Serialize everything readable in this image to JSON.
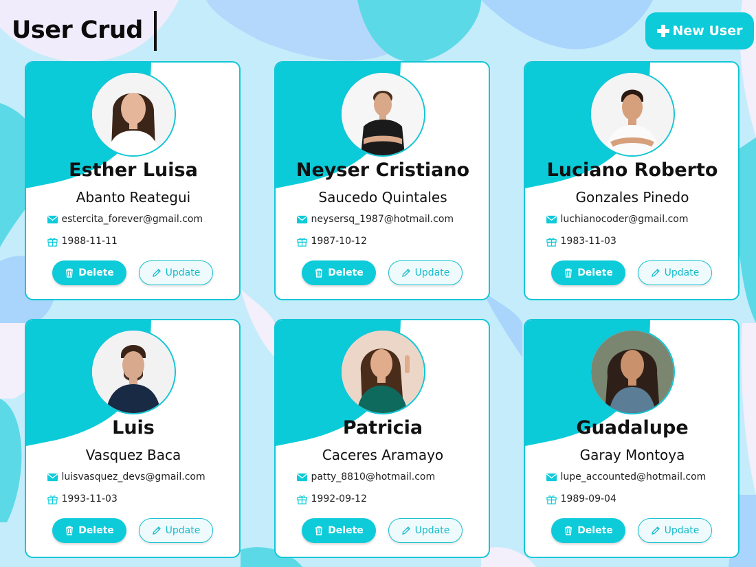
{
  "app": {
    "title": "User Crud",
    "new_user_label": "New User",
    "colors": {
      "accent": "#0dcbd9",
      "card_border": "#12c6d6",
      "background": "#c8ecfb"
    }
  },
  "icons": {
    "new_user": "plus-icon",
    "email": "mail-icon",
    "birthday": "gift-icon",
    "delete": "trash-icon",
    "update": "pencil-icon"
  },
  "cards": [
    {
      "first_name": "Esther Luisa",
      "last_name": "Abanto Reategui",
      "email": "estercita_forever@gmail.com",
      "birthday": "1988-11-11",
      "delete_label": "Delete",
      "update_label": "Update"
    },
    {
      "first_name": "Neyser Cristiano",
      "last_name": "Saucedo Quintales",
      "email": "neysersq_1987@hotmail.com",
      "birthday": "1987-10-12",
      "delete_label": "Delete",
      "update_label": "Update"
    },
    {
      "first_name": "Luciano Roberto",
      "last_name": "Gonzales Pinedo",
      "email": "luchianocoder@gmail.com",
      "birthday": "1983-11-03",
      "delete_label": "Delete",
      "update_label": "Update"
    },
    {
      "first_name": "Luis",
      "last_name": "Vasquez Baca",
      "email": "luisvasquez_devs@gmail.com",
      "birthday": "1993-11-03",
      "delete_label": "Delete",
      "update_label": "Update"
    },
    {
      "first_name": "Patricia",
      "last_name": "Caceres Aramayo",
      "email": "patty_8810@hotmail.com",
      "birthday": "1992-09-12",
      "delete_label": "Delete",
      "update_label": "Update"
    },
    {
      "first_name": "Guadalupe",
      "last_name": "Garay Montoya",
      "email": "lupe_accounted@hotmail.com",
      "birthday": "1989-09-04",
      "delete_label": "Delete",
      "update_label": "Update"
    }
  ]
}
